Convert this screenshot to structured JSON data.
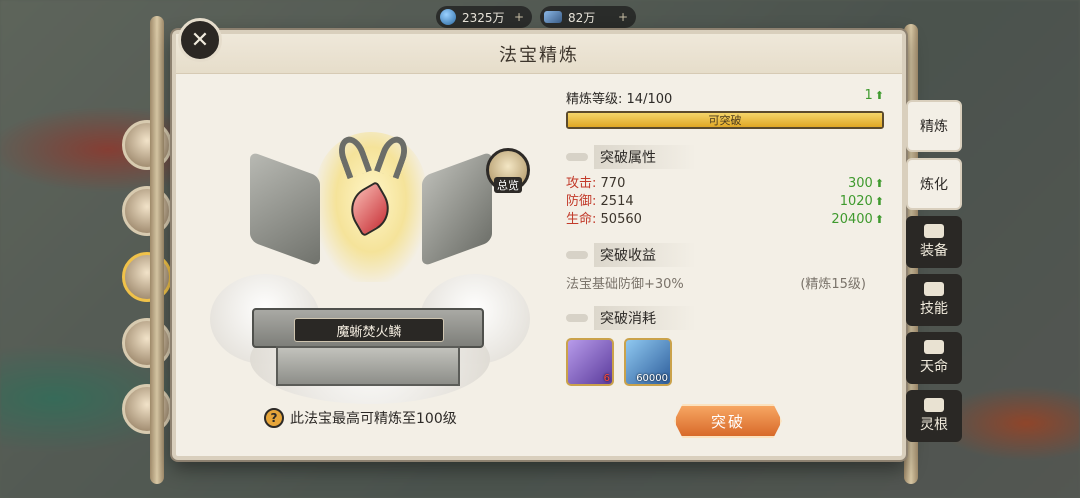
{
  "currency": [
    {
      "name": "gem-currency",
      "value": "2325万"
    },
    {
      "name": "ore-currency",
      "value": "82万"
    }
  ],
  "panel": {
    "title": "法宝精炼",
    "artifact_name": "魔蜥焚火鳞",
    "overview_label": "总览",
    "max_note": "此法宝最高可精炼至100级",
    "help_glyph": "?"
  },
  "refine": {
    "level_label": "精炼等级:",
    "level_value": "14/100",
    "level_gain": "1",
    "progress_fraction": 1.0,
    "progress_text": "可突破"
  },
  "breakthrough_attrs": {
    "title": "突破属性",
    "rows": [
      {
        "key": "攻击:",
        "value": "770",
        "gain": "300"
      },
      {
        "key": "防御:",
        "value": "2514",
        "gain": "1020"
      },
      {
        "key": "生命:",
        "value": "50560",
        "gain": "20400"
      }
    ]
  },
  "breakthrough_gain": {
    "title": "突破收益",
    "text": "法宝基础防御+30%",
    "note": "(精炼15级)"
  },
  "breakthrough_cost": {
    "title": "突破消耗",
    "items": [
      {
        "name": "purple-crystal",
        "qty": "6"
      },
      {
        "name": "blue-ore",
        "qty": "60000"
      }
    ]
  },
  "break_button": "突破",
  "close_glyph": "✕",
  "tabs": [
    "精炼",
    "炼化",
    "装备",
    "技能",
    "天命",
    "灵根"
  ]
}
